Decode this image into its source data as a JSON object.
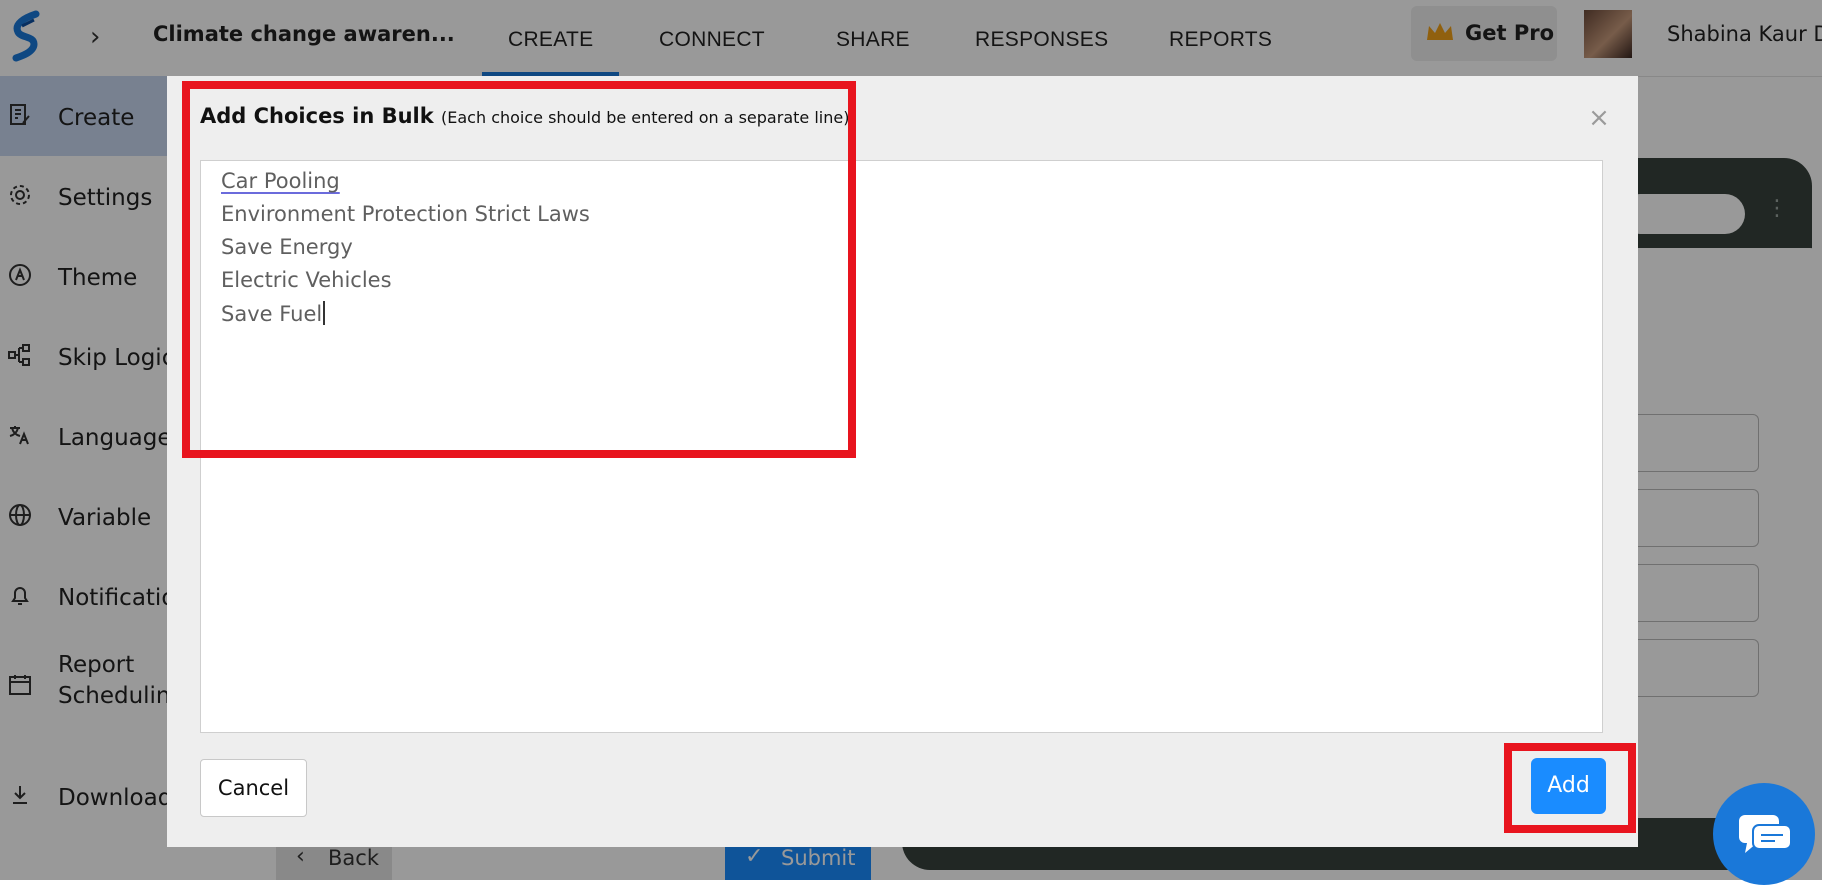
{
  "header": {
    "form_title": "Climate change awaren...",
    "breadcrumb_icon": "chevron-right-icon",
    "tabs": [
      {
        "label": "CREATE",
        "active": true
      },
      {
        "label": "CONNECT",
        "active": false
      },
      {
        "label": "SHARE",
        "active": false
      },
      {
        "label": "RESPONSES",
        "active": false
      },
      {
        "label": "REPORTS",
        "active": false
      }
    ],
    "get_pro_label": "Get Pro",
    "user_name": "Shabina Kaur D"
  },
  "sidebar": {
    "items": [
      {
        "label": "Create",
        "icon": "form-edit-icon",
        "active": true
      },
      {
        "label": "Settings",
        "icon": "gear-icon"
      },
      {
        "label": "Theme",
        "icon": "theme-icon"
      },
      {
        "label": "Skip Logic",
        "icon": "logic-branch-icon"
      },
      {
        "label": "Language",
        "icon": "translate-icon"
      },
      {
        "label": "Variable",
        "icon": "globe-icon"
      },
      {
        "label": "Notifications",
        "icon": "bell-icon"
      },
      {
        "label": "Report Scheduling",
        "icon": "calendar-icon"
      },
      {
        "label": "Download",
        "icon": "download-icon"
      }
    ]
  },
  "editor": {
    "back_label": "Back",
    "submit_label": "Submit"
  },
  "modal": {
    "title": "Add Choices in Bulk",
    "hint": "(Each choice should be entered on a separate line)",
    "choices": [
      "Car Pooling",
      "Environment Protection Strict Laws",
      "Save Energy",
      "Electric Vehicles",
      "Save Fuel"
    ],
    "cancel_label": "Cancel",
    "add_label": "Add",
    "close_icon": "close-icon"
  },
  "colors": {
    "accent": "#1a8cff",
    "tab_underline": "#1a78d9",
    "highlight": "#e8141e",
    "sidebar_active": "#c8d8f0",
    "preview_frame": "#37413c"
  }
}
